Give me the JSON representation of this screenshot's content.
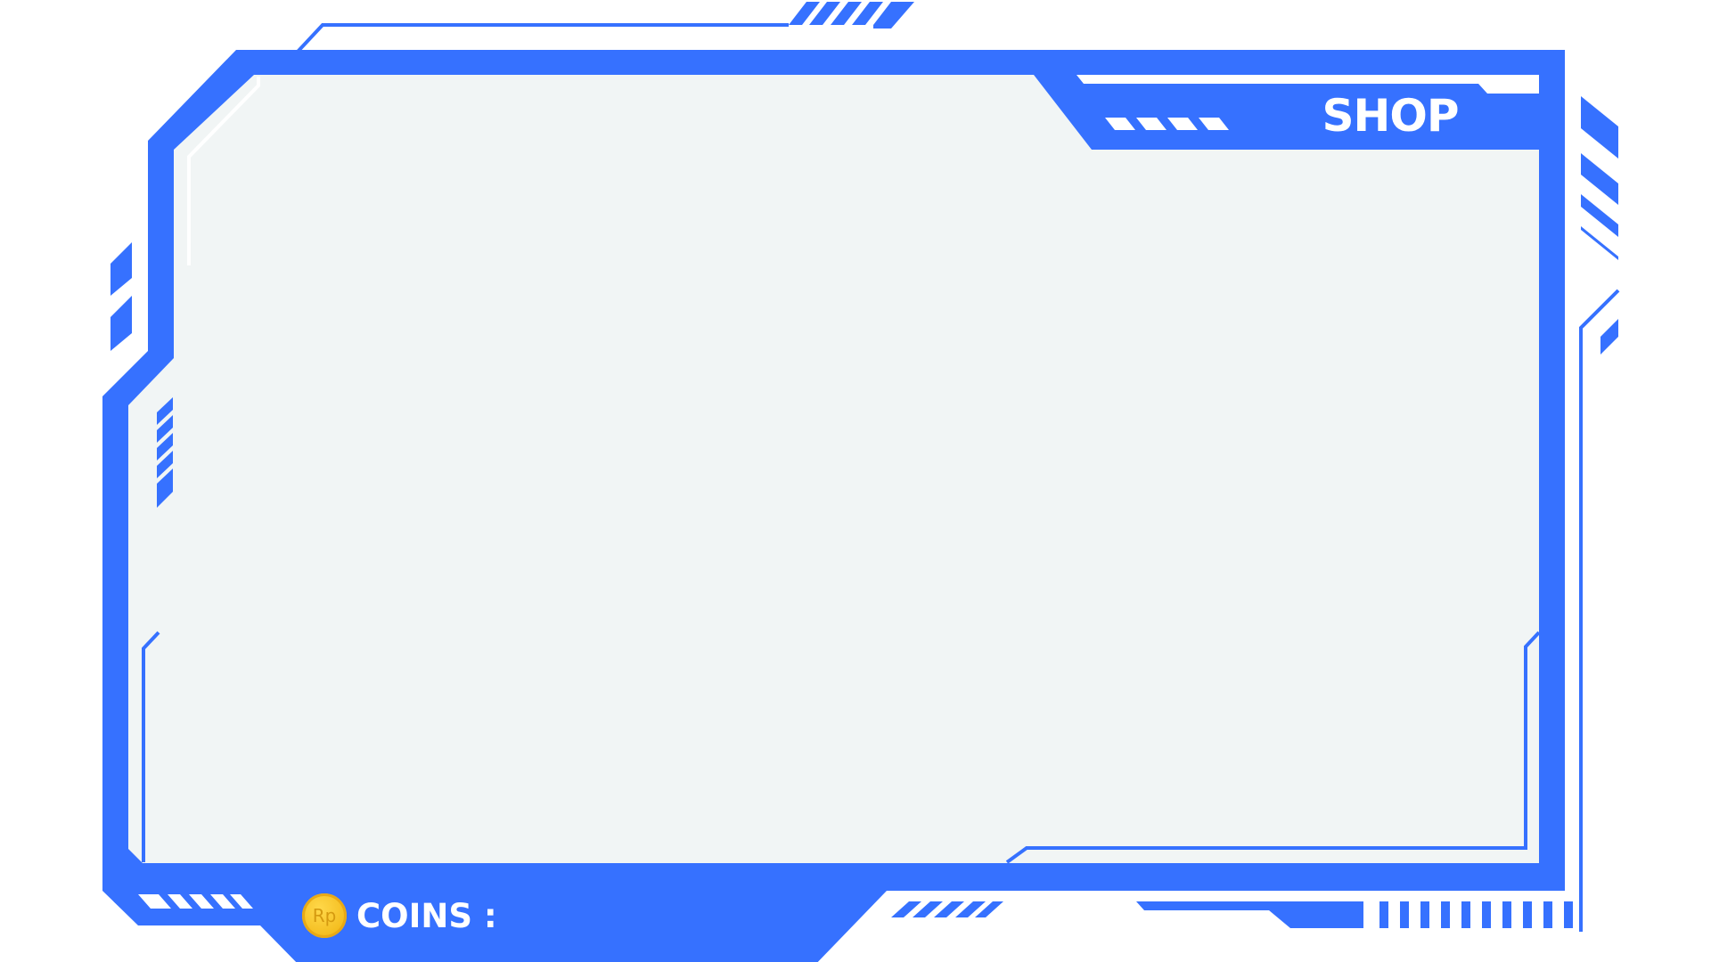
{
  "theme": {
    "primary": "#3671ff",
    "panel_bg": "#f1f5f5",
    "background": "#ffffff",
    "coin": "#f4bd1f",
    "text": "#ffffff"
  },
  "header": {
    "title": "SHOP"
  },
  "footer": {
    "coin_icon_name": "rupiah-coin-icon",
    "coin_symbol": "Rp",
    "coins_label": "COINS :"
  }
}
